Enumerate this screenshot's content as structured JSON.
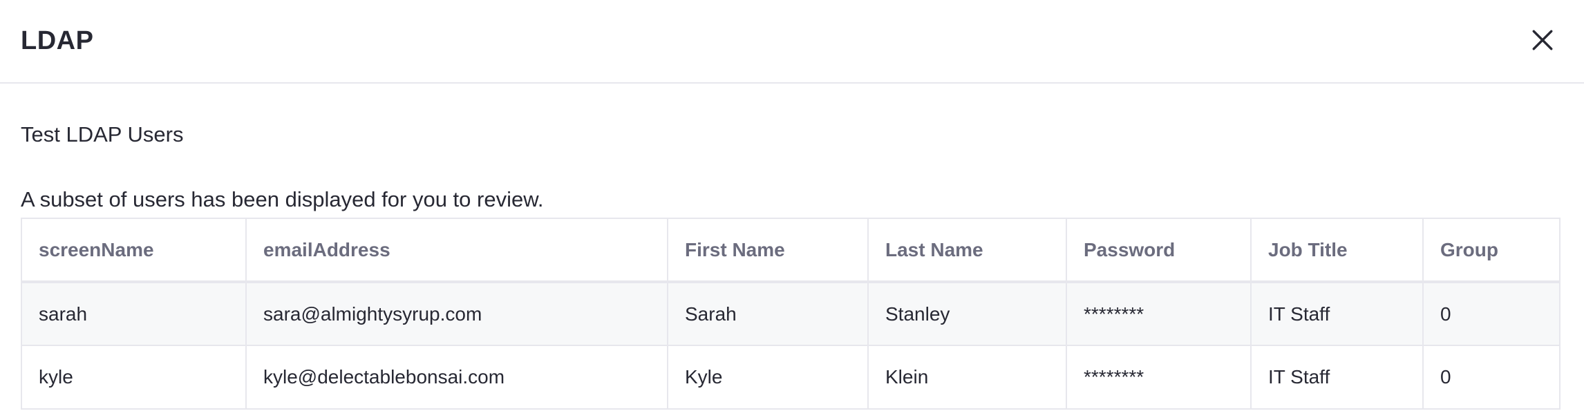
{
  "modal": {
    "title": "LDAP",
    "close_icon": "close-icon"
  },
  "content": {
    "section_title": "Test LDAP Users",
    "description": "A subset of users has been displayed for you to review."
  },
  "table": {
    "columns": [
      "screenName",
      "emailAddress",
      "First Name",
      "Last Name",
      "Password",
      "Job Title",
      "Group"
    ],
    "rows": [
      [
        "sarah",
        "sara@almightysyrup.com",
        "Sarah",
        "Stanley",
        "********",
        "IT Staff",
        "0"
      ],
      [
        "kyle",
        "kyle@delectablebonsai.com",
        "Kyle",
        "Klein",
        "********",
        "IT Staff",
        "0"
      ]
    ]
  },
  "colors": {
    "border": "#e7e7ed",
    "header_text": "#6b6c7e",
    "body_text": "#272833",
    "striped_row": "#f7f8f9"
  }
}
